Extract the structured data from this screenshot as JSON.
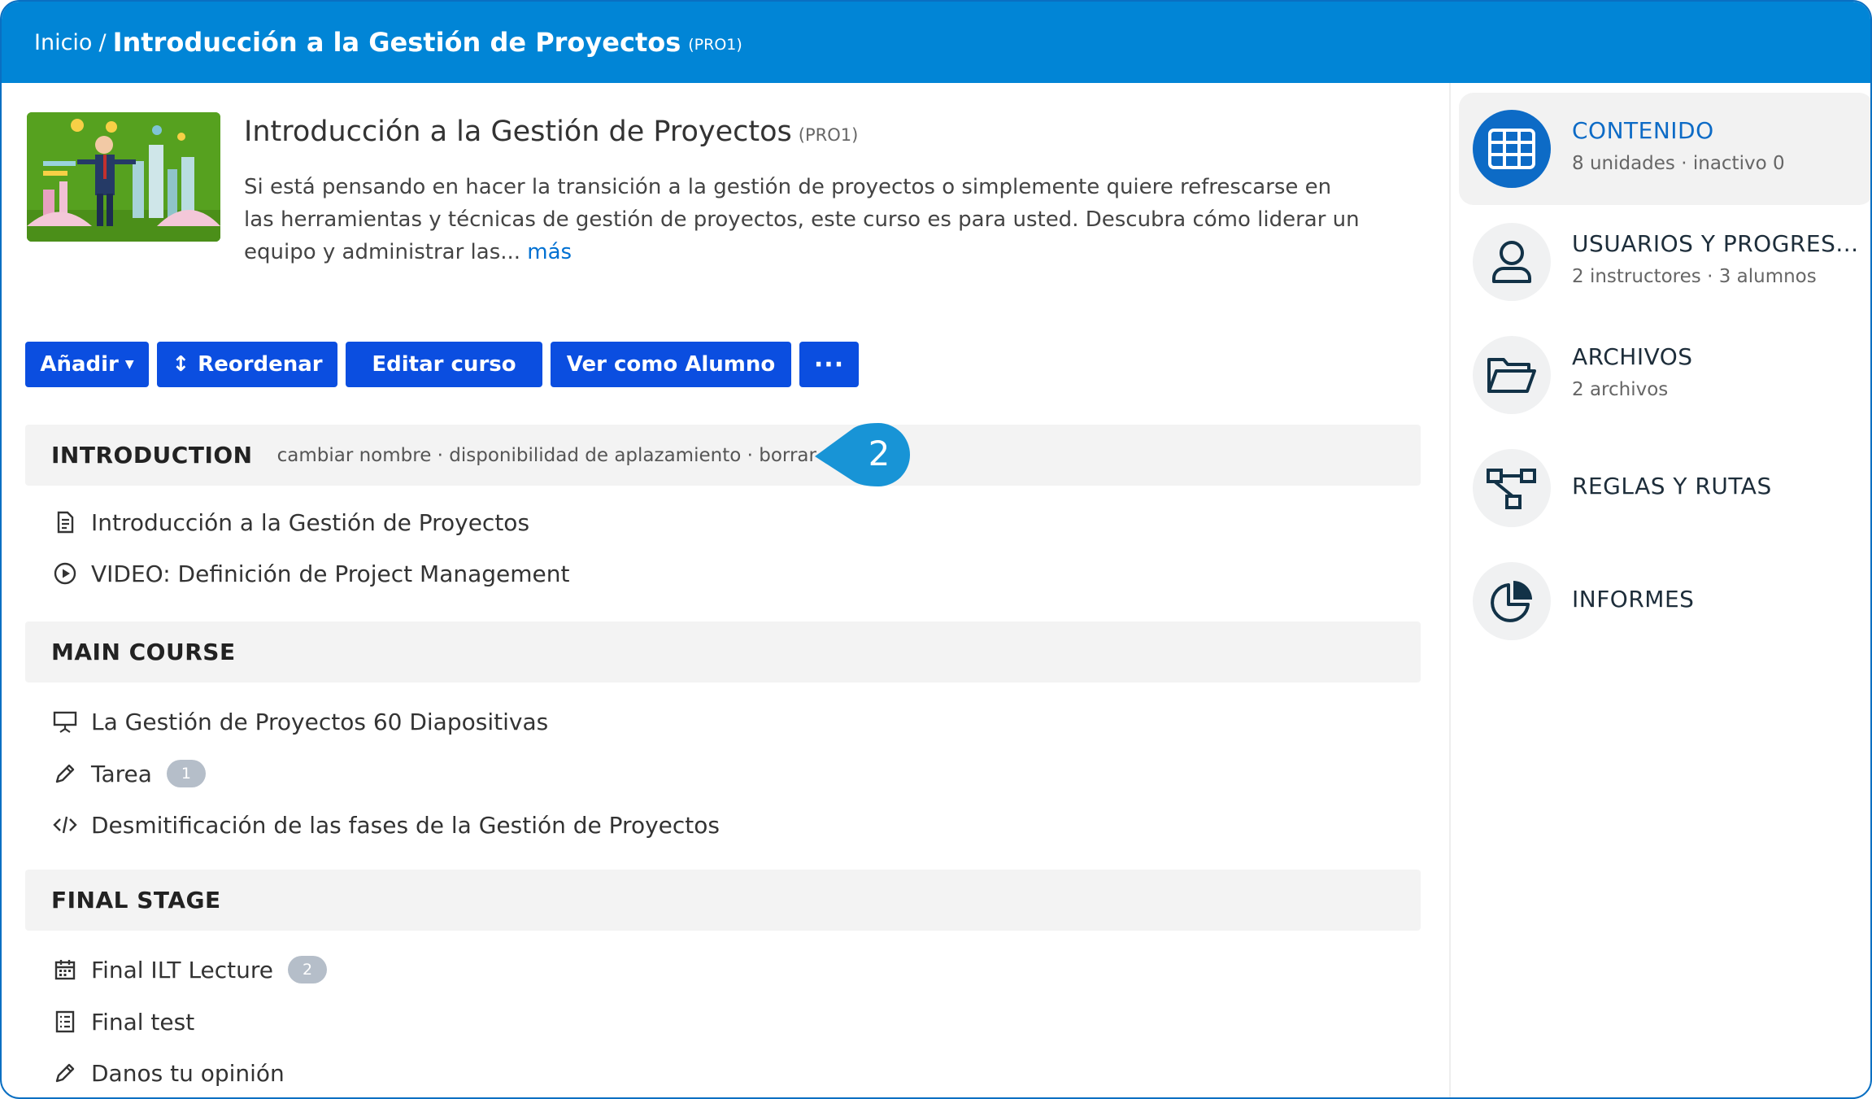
{
  "breadcrumb": {
    "home": "Inicio",
    "separator": "/",
    "current": "Introducción a la Gestión de Proyectos",
    "code": "(PRO1)"
  },
  "course": {
    "title": "Introducción a la Gestión de Proyectos",
    "code": "(PRO1)",
    "description": "Si está pensando en hacer la transición a la gestión de proyectos o simplemente quiere refrescarse en las herramientas y técnicas de gestión de proyectos, este curso es para usted. Descubra cómo liderar un equipo y administrar las...",
    "more_label": "más"
  },
  "actions": {
    "add": "Añadir",
    "reorder": "Reordenar",
    "edit": "Editar curso",
    "view_as_student": "Ver como Alumno",
    "more": "···"
  },
  "callout": {
    "number": "2"
  },
  "sections": [
    {
      "title": "INTRODUCTION",
      "links": "cambiar nombre · disponibilidad de aplazamiento · borrar",
      "items": [
        {
          "icon": "document-icon",
          "label": "Introducción a la Gestión de Proyectos"
        },
        {
          "icon": "play-icon",
          "label": "VIDEO: Definición de Project Management"
        }
      ]
    },
    {
      "title": "MAIN COURSE",
      "items": [
        {
          "icon": "presentation-icon",
          "label": "La Gestión de Proyectos 60 Diapositivas"
        },
        {
          "icon": "pencil-icon",
          "label": "Tarea",
          "badge": "1"
        },
        {
          "icon": "code-icon",
          "label": "Desmitificación de las fases de la Gestión de Proyectos"
        }
      ]
    },
    {
      "title": "FINAL STAGE",
      "items": [
        {
          "icon": "calendar-icon",
          "label": "Final ILT Lecture",
          "badge": "2"
        },
        {
          "icon": "checklist-icon",
          "label": "Final test"
        },
        {
          "icon": "pencil-icon",
          "label": "Danos tu opinión"
        }
      ]
    }
  ],
  "sidebar": {
    "items": [
      {
        "icon": "grid-icon",
        "label": "CONTENIDO",
        "sub": "8 unidades · inactivo 0",
        "active": true
      },
      {
        "icon": "user-icon",
        "label": "USUARIOS Y PROGRES...",
        "sub": "2 instructores · 3 alumnos"
      },
      {
        "icon": "folder-icon",
        "label": "ARCHIVOS",
        "sub": "2 archivos"
      },
      {
        "icon": "flow-icon",
        "label": "REGLAS Y RUTAS"
      },
      {
        "icon": "pie-chart-icon",
        "label": "INFORMES"
      }
    ]
  },
  "colors": {
    "topbar": "#0185d6",
    "button": "#0b4ee0",
    "active": "#0d6bc6",
    "callout": "#1894d6"
  }
}
